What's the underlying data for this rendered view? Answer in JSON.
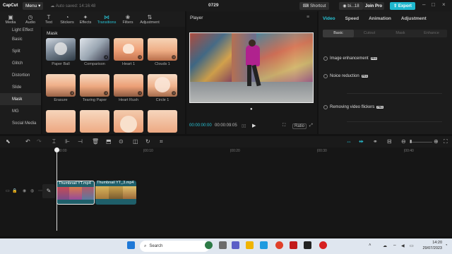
{
  "app": {
    "name": "CapCut",
    "menu": "Menu",
    "autosave": "Auto saved: 14:16:48",
    "project_title": "0729",
    "shortcut": "Shortcut",
    "account": "bi...18",
    "join_pro": "Join Pro",
    "export": "Export"
  },
  "left_toolbar": [
    {
      "label": "Media",
      "icon": "media-icon"
    },
    {
      "label": "Audio",
      "icon": "audio-icon"
    },
    {
      "label": "Text",
      "icon": "text-icon"
    },
    {
      "label": "Stickers",
      "icon": "stickers-icon"
    },
    {
      "label": "Effects",
      "icon": "effects-icon"
    },
    {
      "label": "Transitions",
      "icon": "transitions-icon",
      "active": true
    },
    {
      "label": "Filters",
      "icon": "filters-icon"
    },
    {
      "label": "Adjustment",
      "icon": "adjustment-icon"
    }
  ],
  "sidebar": {
    "items": [
      {
        "label": "Light Effect"
      },
      {
        "label": "Basic"
      },
      {
        "label": "Split"
      },
      {
        "label": "Glitch"
      },
      {
        "label": "Distortion"
      },
      {
        "label": "Slide"
      },
      {
        "label": "Mask",
        "active": true
      },
      {
        "label": "MG"
      },
      {
        "label": "Social Media"
      }
    ]
  },
  "section_title": "Mask",
  "transitions": [
    {
      "label": "Paper Ball"
    },
    {
      "label": "Comparison"
    },
    {
      "label": "Heart 1"
    },
    {
      "label": "Clouds 1"
    },
    {
      "label": "Erasure"
    },
    {
      "label": "Tearing Paper"
    },
    {
      "label": "Heart Rush"
    },
    {
      "label": "Circle 1"
    },
    {
      "label": ""
    },
    {
      "label": ""
    },
    {
      "label": ""
    },
    {
      "label": ""
    }
  ],
  "player": {
    "title": "Player",
    "current_time": "00:00:00:00",
    "total_time": "00:00:09:05",
    "ratio": "Ratio"
  },
  "right_panel": {
    "tabs": [
      "Video",
      "Speed",
      "Animation",
      "Adjustment"
    ],
    "subtabs": [
      "Basic",
      "Cutout",
      "Mask",
      "Enhance"
    ],
    "options": [
      "Image enhancement",
      "Noice reduction",
      "Removing video flickers"
    ],
    "pro_badge": "PRO"
  },
  "timeline": {
    "ruler": [
      "00:00",
      "|00:10",
      "|00:20",
      "|00:30",
      "|00:40"
    ],
    "clips": [
      {
        "label": "Thumbnail YT.mp4"
      },
      {
        "label": "Thumbnail YT_3.mp4"
      }
    ]
  },
  "taskbar": {
    "search": "Search",
    "time": "14:20",
    "date": "29/07/2023"
  },
  "colors": {
    "accent": "#28c4d6",
    "export": "#1fb8ce",
    "join_pro": "#2a2a2a"
  }
}
